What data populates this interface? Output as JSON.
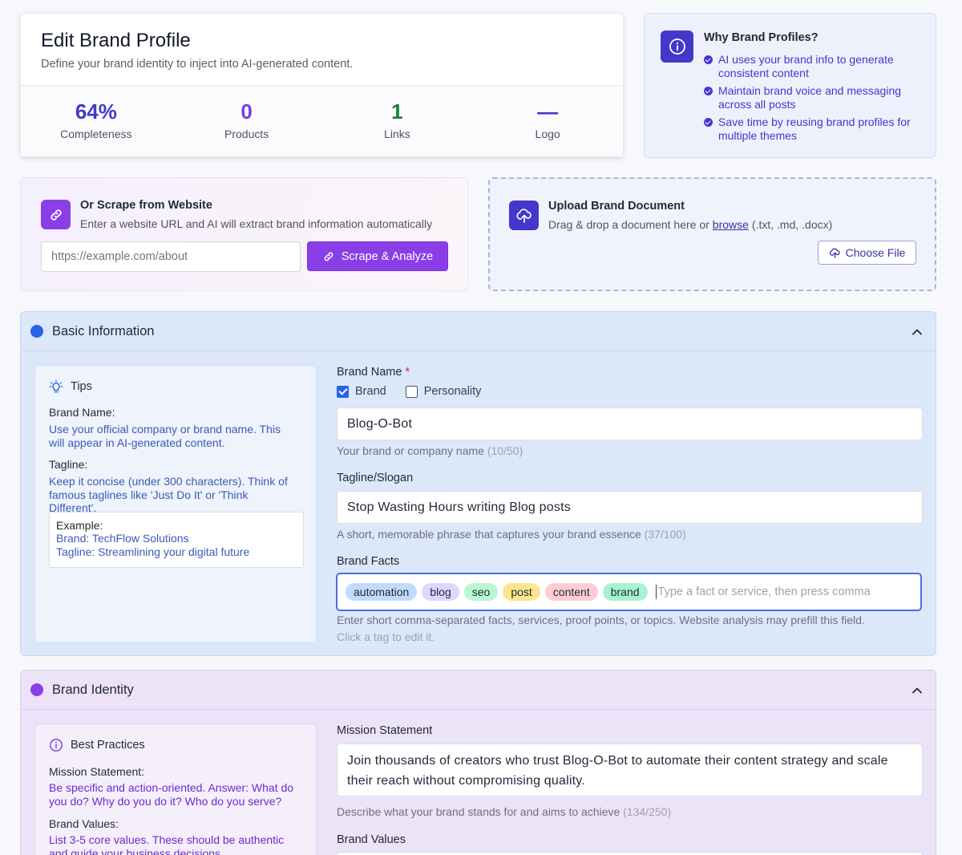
{
  "header": {
    "title": "Edit Brand Profile",
    "subtitle": "Define your brand identity to inject into AI-generated content.",
    "stats": [
      {
        "value": "64%",
        "label": "Completeness",
        "color": "#4338ca"
      },
      {
        "value": "0",
        "label": "Products",
        "color": "#7c3aed"
      },
      {
        "value": "1",
        "label": "Links",
        "color": "#15803d"
      },
      {
        "value": "—",
        "label": "Logo",
        "color": "#4338ca"
      }
    ]
  },
  "why": {
    "title": "Why Brand Profiles?",
    "items": [
      "AI uses your brand info to generate consistent content",
      "Maintain brand voice and messaging across all posts",
      "Save time by reusing brand profiles for multiple themes"
    ]
  },
  "scrape": {
    "title": "Or Scrape from Website",
    "subtitle": "Enter a website URL and AI will extract brand information automatically",
    "placeholder": "https://example.com/about",
    "button_label": "Scrape & Analyze"
  },
  "upload": {
    "title": "Upload Brand Document",
    "subtitle_before": "Drag & drop a document here or",
    "browse_label": "browse",
    "subtitle_after": "(.txt, .md, .docx)",
    "button_label": "Choose File"
  },
  "basic": {
    "title": "Basic Information",
    "dot_color": "#2563eb",
    "tips": {
      "title": "Tips",
      "brand_name_label": "Brand Name:",
      "brand_name_text": "Use your official company or brand name. This will appear in AI-generated content.",
      "tagline_label": "Tagline:",
      "tagline_text": "Keep it concise (under 300 characters). Think of famous taglines like 'Just Do It' or 'Think Different'.",
      "example_label": "Example:",
      "example_brand": "Brand: TechFlow Solutions",
      "example_tagline": "Tagline: Streamlining your digital future"
    },
    "brand_name": {
      "label": "Brand Name",
      "required": "*",
      "option_brand": "Brand",
      "option_brand_checked": true,
      "option_personality": "Personality",
      "option_personality_checked": false,
      "value": "Blog-O-Bot",
      "hint": "Your brand or company name",
      "count": "(10/50)"
    },
    "tagline": {
      "label": "Tagline/Slogan",
      "value": "Stop Wasting Hours writing Blog posts",
      "hint": "A short, memorable phrase that captures your brand essence",
      "count": "(37/100)"
    },
    "facts": {
      "label": "Brand Facts",
      "tags": [
        {
          "text": "automation",
          "color": "#bfdbfe"
        },
        {
          "text": "blog",
          "color": "#ddd6fe"
        },
        {
          "text": "seo",
          "color": "#bbf7d0"
        },
        {
          "text": "post",
          "color": "#fde68a"
        },
        {
          "text": "content",
          "color": "#fecdd3"
        },
        {
          "text": "brand",
          "color": "#a7f3d0"
        }
      ],
      "placeholder": "Type a fact or service, then press comma",
      "hint": "Enter short comma-separated facts, services, proof points, or topics. Website analysis may prefill this field.",
      "hint2": "Click a tag to edit it."
    }
  },
  "identity": {
    "title": "Brand Identity",
    "dot_color": "#8b3ee8",
    "best_practices": {
      "title": "Best Practices",
      "mission_label": "Mission Statement:",
      "mission_text": "Be specific and action-oriented. Answer: What do you do? Why do you do it? Who do you serve?",
      "values_label": "Brand Values:",
      "values_text": "List 3-5 core values. These should be authentic and guide your business decisions."
    },
    "mission": {
      "label": "Mission Statement",
      "value": "Join thousands of creators who trust Blog-O-Bot to automate their content strategy and scale their reach without compromising quality.",
      "hint": "Describe what your brand stands for and aims to achieve",
      "count": "(134/250)"
    },
    "values": {
      "label": "Brand Values"
    }
  }
}
